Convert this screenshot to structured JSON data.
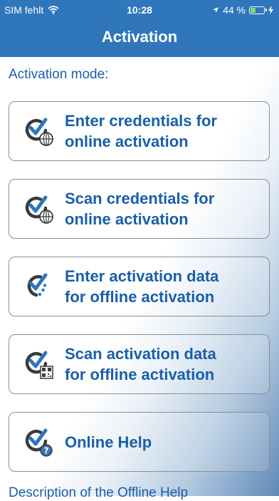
{
  "status_bar": {
    "carrier": "SIM fehlt",
    "time": "10:28",
    "battery_text": "44 %",
    "battery_level": 0.44
  },
  "nav": {
    "title": "Activation"
  },
  "activation_mode_label": "Activation mode:",
  "buttons": [
    {
      "label": "Enter credentials for\nonline activation",
      "icon": "checkmark-globe-icon"
    },
    {
      "label": "Scan credentials for\nonline activation",
      "icon": "checkmark-globe-icon"
    },
    {
      "label": "Enter activation data\nfor offline activation",
      "icon": "checkmark-dots-icon"
    },
    {
      "label": "Scan activation data\nfor offline activation",
      "icon": "checkmark-qr-icon"
    },
    {
      "label": "Online Help",
      "icon": "checkmark-help-icon"
    }
  ],
  "footer_text": "Description of the Offline Help",
  "colors": {
    "bar_blue": "#2f76bb",
    "text_blue": "#1b5fa8",
    "icon_dark": "#3b3b3b"
  }
}
